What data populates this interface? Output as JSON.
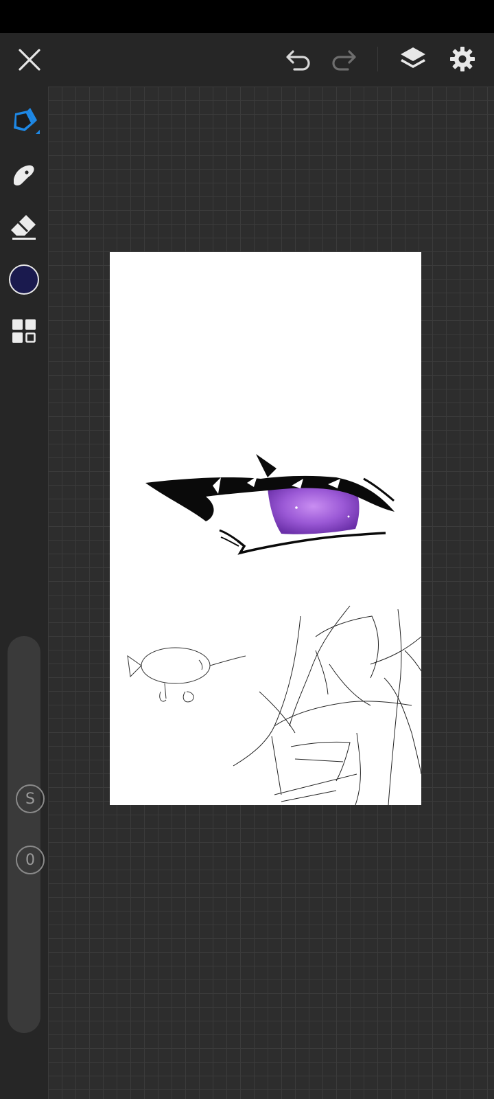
{
  "app": {
    "accent_color": "#1e88e5",
    "current_color": "#1a1a4e",
    "canvas_background": "#ffffff",
    "workspace_background": "#2d2d2d"
  },
  "toolbar": {
    "close_icon": "close-icon",
    "undo_icon": "undo-icon",
    "redo_icon": "redo-icon",
    "layers_icon": "layers-icon",
    "settings_icon": "gear-icon"
  },
  "tools": [
    {
      "name": "pen",
      "icon": "pen-icon",
      "active": true
    },
    {
      "name": "smudge",
      "icon": "smudge-icon",
      "active": false
    },
    {
      "name": "eraser",
      "icon": "eraser-icon",
      "active": false
    },
    {
      "name": "color",
      "icon": "color-swatch",
      "active": false
    },
    {
      "name": "tool-grid",
      "icon": "grid-icon",
      "active": false
    }
  ],
  "sliders": {
    "size_label": "S",
    "opacity_label": "0"
  }
}
